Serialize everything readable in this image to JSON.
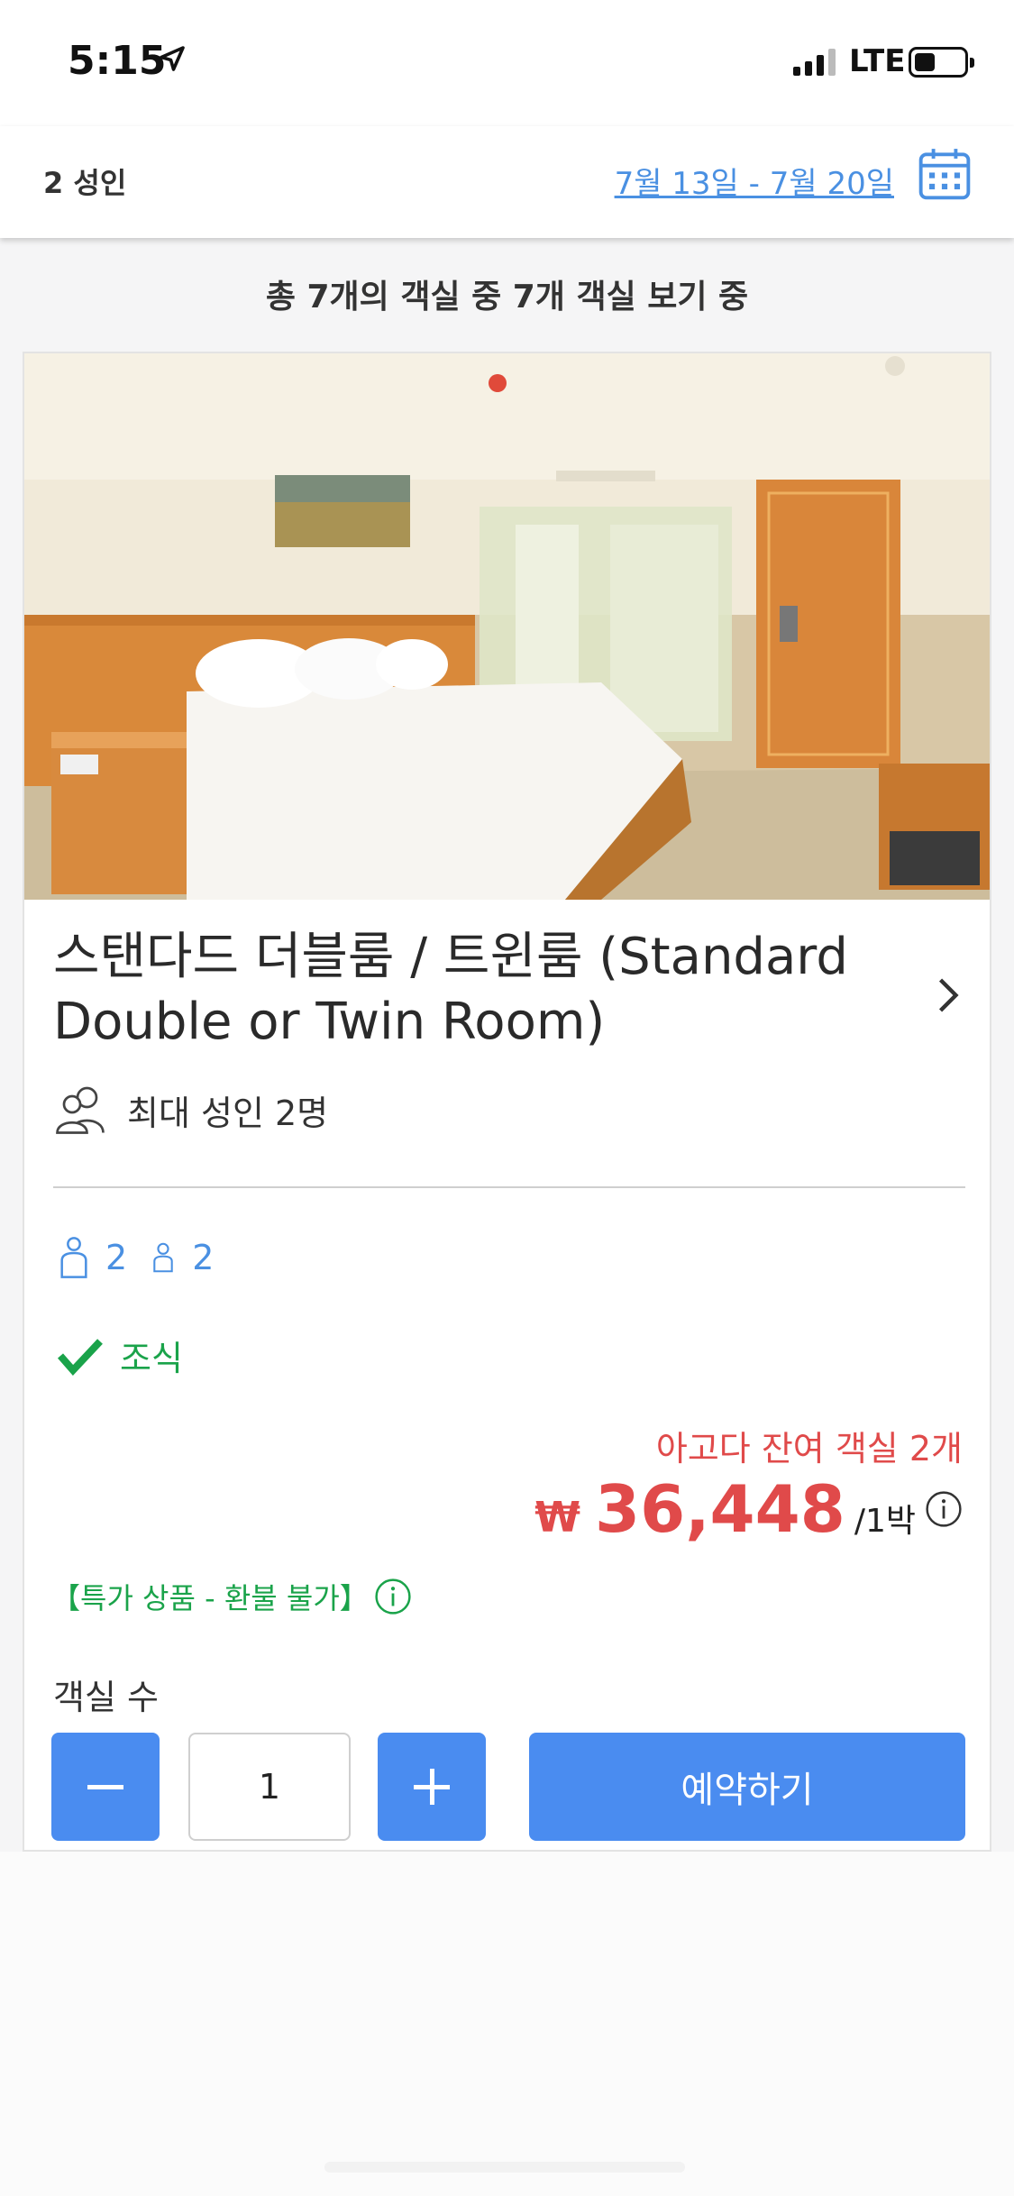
{
  "status_bar": {
    "time": "5:15",
    "network": "LTE"
  },
  "header": {
    "guests": "2 성인",
    "date_range": "7월 13일 - 7월 20일",
    "calendar_icon": "calendar-icon"
  },
  "summary": "총 7개의 객실 중 7개 객실 보기 중",
  "room": {
    "title": "스탠다드 더블룸 / 트윈룸 (Standard Double or Twin Room)",
    "occupancy": "최대 성인 2명",
    "beds": [
      {
        "icon": "double-bed-icon",
        "count": "2"
      },
      {
        "icon": "single-bed-icon",
        "count": "2"
      }
    ],
    "breakfast": "조식",
    "rooms_left": "아고다 잔여 객실 2개",
    "price": {
      "currency": "₩",
      "amount": "36,448",
      "unit": "/1박"
    },
    "deal_label": "【특가 상품 - 환불 불가】",
    "rooms_count_label": "객실 수",
    "rooms_count_value": "1",
    "book_label": "예약하기"
  },
  "colors": {
    "accent_blue": "#4a8cf0",
    "link_blue": "#4a90e2",
    "price_red": "#e04a4a",
    "green": "#1aa34a"
  }
}
